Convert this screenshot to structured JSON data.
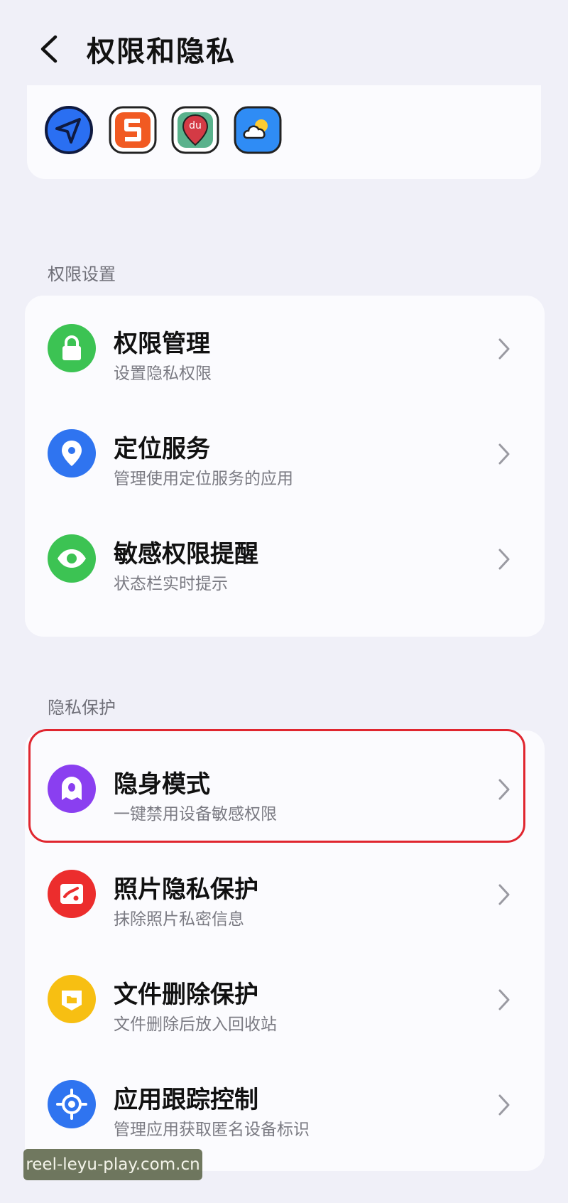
{
  "header": {
    "title": "权限和隐私"
  },
  "apps": [
    {
      "name": "navigation-app-icon",
      "color": "#2a6ff2"
    },
    {
      "name": "sogou-app-icon",
      "color": "#f15a22"
    },
    {
      "name": "baidu-map-app-icon",
      "color": "#d43a45"
    },
    {
      "name": "weather-app-icon",
      "color": "#2f8cf5"
    }
  ],
  "permission_section": {
    "title": "权限设置",
    "items": [
      {
        "title": "权限管理",
        "subtitle": "设置隐私权限",
        "icon": "lock-icon",
        "color": "#3cc353"
      },
      {
        "title": "定位服务",
        "subtitle": "管理使用定位服务的应用",
        "icon": "location-pin-icon",
        "color": "#2f74f0"
      },
      {
        "title": "敏感权限提醒",
        "subtitle": "状态栏实时提示",
        "icon": "eye-icon",
        "color": "#3cc353"
      }
    ]
  },
  "privacy_section": {
    "title": "隐私保护",
    "items": [
      {
        "title": "隐身模式",
        "subtitle": "一键禁用设备敏感权限",
        "icon": "ghost-icon",
        "color": "#8a3ff0"
      },
      {
        "title": "照片隐私保护",
        "subtitle": "抹除照片私密信息",
        "icon": "photo-icon",
        "color": "#ec2d2d"
      },
      {
        "title": "文件删除保护",
        "subtitle": "文件删除后放入回收站",
        "icon": "folder-icon",
        "color": "#f7bf12"
      },
      {
        "title": "应用跟踪控制",
        "subtitle": "管理应用获取匿名设备标识",
        "icon": "crosshair-icon",
        "color": "#2f74f0"
      }
    ]
  },
  "watermark": "reel-leyu-play.com.cn"
}
